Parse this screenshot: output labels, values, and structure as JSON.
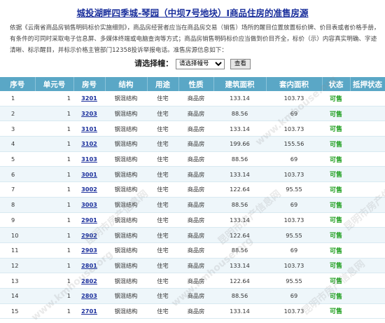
{
  "page": {
    "title": "城投湖畔四季城-琴园（中坝7号地块）Ⅰ商品住房的准售房源",
    "notice": "依据《云南省商品房销售明码标价实施细则》，商品房经营者应当在商品房交易（销售）场所的醒目位置放置标价牌、价目表或者价格手册，有条件的可同时采取电子信息屏、多媒体终端或电脑查询等方式；商品房销售明码标价应当做到价目齐全，标价（示）内容真实明确、字迹清晰、标示醒目，并标示价格主管部门12358投诉举报电话。准售房源信息如下：",
    "select_label": "请选择幢：",
    "select_value": "请选择幢号",
    "search_button": "查看"
  },
  "table": {
    "headers": [
      "序号",
      "单元号",
      "房号",
      "结构",
      "用途",
      "性质",
      "建筑面积",
      "套内面积",
      "状态",
      "抵押状态"
    ],
    "rows": [
      {
        "idx": "1",
        "unit": "1",
        "room": "3201",
        "struct": "钢混结构",
        "use": "住宅",
        "nature": "商品房",
        "area": "133.14",
        "inner": "103.73",
        "status": "可售",
        "mortgage": ""
      },
      {
        "idx": "2",
        "unit": "1",
        "room": "3203",
        "struct": "钢混结构",
        "use": "住宅",
        "nature": "商品房",
        "area": "88.56",
        "inner": "69",
        "status": "可售",
        "mortgage": ""
      },
      {
        "idx": "3",
        "unit": "1",
        "room": "3101",
        "struct": "钢混结构",
        "use": "住宅",
        "nature": "商品房",
        "area": "133.14",
        "inner": "103.73",
        "status": "可售",
        "mortgage": ""
      },
      {
        "idx": "4",
        "unit": "1",
        "room": "3102",
        "struct": "钢混结构",
        "use": "住宅",
        "nature": "商品房",
        "area": "199.66",
        "inner": "155.56",
        "status": "可售",
        "mortgage": ""
      },
      {
        "idx": "5",
        "unit": "1",
        "room": "3103",
        "struct": "钢混结构",
        "use": "住宅",
        "nature": "商品房",
        "area": "88.56",
        "inner": "69",
        "status": "可售",
        "mortgage": ""
      },
      {
        "idx": "6",
        "unit": "1",
        "room": "3001",
        "struct": "钢混结构",
        "use": "住宅",
        "nature": "商品房",
        "area": "133.14",
        "inner": "103.73",
        "status": "可售",
        "mortgage": ""
      },
      {
        "idx": "7",
        "unit": "1",
        "room": "3002",
        "struct": "钢混结构",
        "use": "住宅",
        "nature": "商品房",
        "area": "122.64",
        "inner": "95.55",
        "status": "可售",
        "mortgage": ""
      },
      {
        "idx": "8",
        "unit": "1",
        "room": "3003",
        "struct": "钢混结构",
        "use": "住宅",
        "nature": "商品房",
        "area": "88.56",
        "inner": "69",
        "status": "可售",
        "mortgage": ""
      },
      {
        "idx": "9",
        "unit": "1",
        "room": "2901",
        "struct": "钢混结构",
        "use": "住宅",
        "nature": "商品房",
        "area": "133.14",
        "inner": "103.73",
        "status": "可售",
        "mortgage": ""
      },
      {
        "idx": "10",
        "unit": "1",
        "room": "2902",
        "struct": "钢混结构",
        "use": "住宅",
        "nature": "商品房",
        "area": "122.64",
        "inner": "95.55",
        "status": "可售",
        "mortgage": ""
      },
      {
        "idx": "11",
        "unit": "1",
        "room": "2903",
        "struct": "钢混结构",
        "use": "住宅",
        "nature": "商品房",
        "area": "88.56",
        "inner": "69",
        "status": "可售",
        "mortgage": ""
      },
      {
        "idx": "12",
        "unit": "1",
        "room": "2801",
        "struct": "钢混结构",
        "use": "住宅",
        "nature": "商品房",
        "area": "133.14",
        "inner": "103.73",
        "status": "可售",
        "mortgage": ""
      },
      {
        "idx": "13",
        "unit": "1",
        "room": "2802",
        "struct": "钢混结构",
        "use": "住宅",
        "nature": "商品房",
        "area": "122.64",
        "inner": "95.55",
        "status": "可售",
        "mortgage": ""
      },
      {
        "idx": "14",
        "unit": "1",
        "room": "2803",
        "struct": "钢混结构",
        "use": "住宅",
        "nature": "商品房",
        "area": "88.56",
        "inner": "69",
        "status": "可售",
        "mortgage": ""
      },
      {
        "idx": "15",
        "unit": "1",
        "room": "2701",
        "struct": "钢混结构",
        "use": "住宅",
        "nature": "商品房",
        "area": "133.14",
        "inner": "103.73",
        "status": "可售",
        "mortgage": ""
      }
    ]
  },
  "watermark": {
    "text_cn": "昆明市房产信息网",
    "text_en": "www.kmhouse.org"
  },
  "colors": {
    "header_bg": "#5aa7c6",
    "title": "#1a2f9c",
    "status": "#1e9e1e"
  }
}
